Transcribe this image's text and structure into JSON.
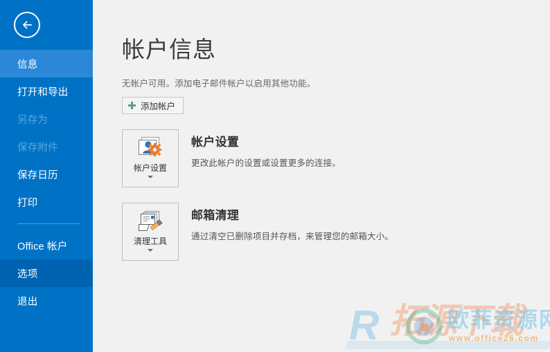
{
  "sidebar": {
    "back_button": {
      "name": "返回",
      "icon": "back-arrow-icon"
    },
    "items": [
      {
        "label": "信息",
        "state": "selected"
      },
      {
        "label": "打开和导出",
        "state": "normal"
      },
      {
        "label": "另存为",
        "state": "disabled"
      },
      {
        "label": "保存附件",
        "state": "disabled"
      },
      {
        "label": "保存日历",
        "state": "normal"
      },
      {
        "label": "打印",
        "state": "normal"
      },
      {
        "label": "Office 帐户",
        "state": "normal"
      },
      {
        "label": "选项",
        "state": "hovered"
      },
      {
        "label": "退出",
        "state": "normal"
      }
    ],
    "colors": {
      "background": "#0072c6",
      "selected": "#2b88d8",
      "hovered": "#0063b1",
      "disabled_text": "#58a7de",
      "text": "#ffffff",
      "divider": "#4f9fd8"
    }
  },
  "main": {
    "page_title": "帐户信息",
    "subtitle": "无帐户可用。添加电子邮件帐户以启用其他功能。",
    "add_account_button": "添加帐户",
    "features": [
      {
        "tile_label": "帐户设置",
        "tile_icon": "account-settings-icon",
        "heading": "帐户设置",
        "description": "更改此帐户的设置或设置更多的连接。"
      },
      {
        "tile_label": "清理工具",
        "tile_icon": "mailbox-cleanup-icon",
        "heading": "邮箱清理",
        "description": "通过清空已删除项目并存档，来管理您的邮箱大小。"
      }
    ],
    "colors": {
      "background": "#f1f1f1",
      "title_text": "#3b3b3b",
      "body_text": "#555555",
      "tile_border": "#bfbfbf",
      "plus_green": "#5f9e7f",
      "gear_orange": "#ed7d31",
      "person_blue": "#2e75b6"
    }
  },
  "watermark": {
    "letter": "R",
    "overlay_text": "拓源下载",
    "site_name": "欧菲资源网",
    "site_url": "www.office26.com"
  }
}
